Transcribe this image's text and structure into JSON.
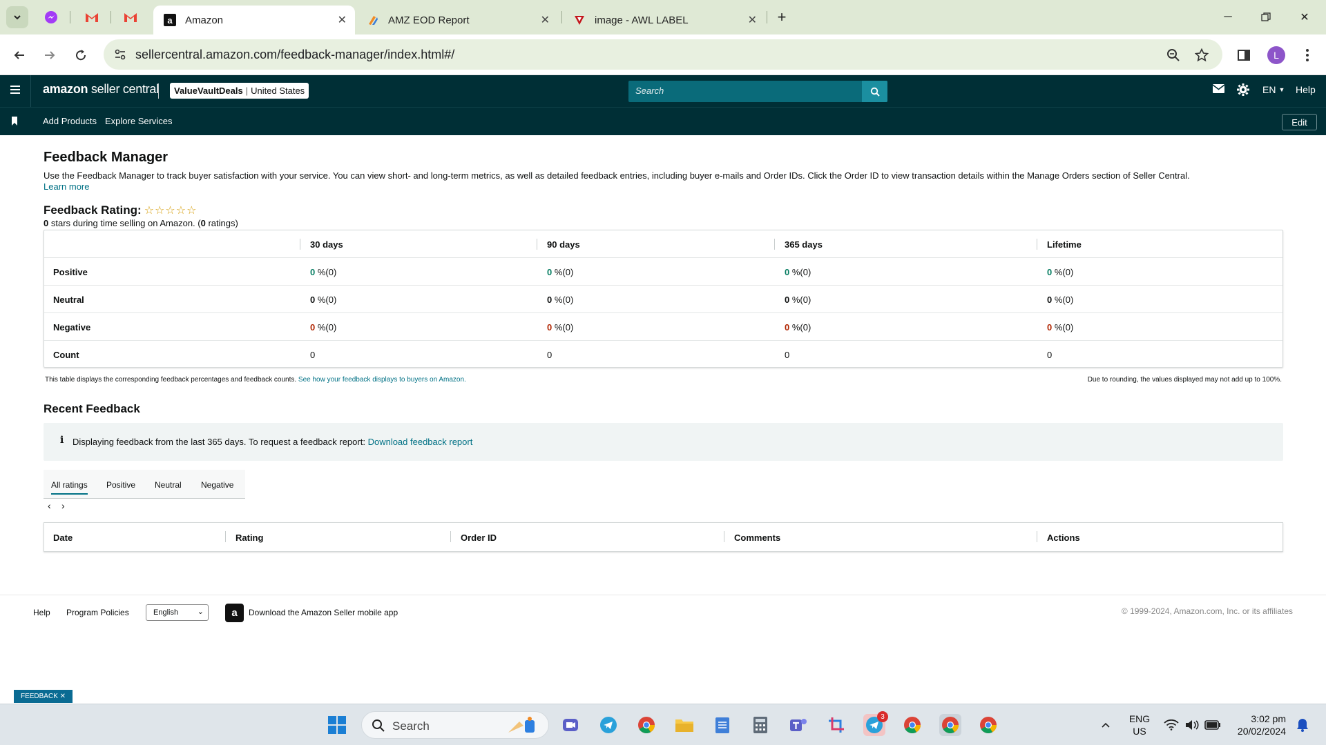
{
  "browser": {
    "tabs": [
      {
        "title": "Amazon",
        "active": true
      },
      {
        "title": "AMZ EOD Report",
        "active": false
      },
      {
        "title": "image - AWL LABEL",
        "active": false
      }
    ],
    "url": "sellercentral.amazon.com/feedback-manager/index.html#/",
    "profile_initial": "L"
  },
  "header": {
    "logo_main": "amazon",
    "logo_sub": "seller central",
    "store_name": "ValueVaultDeals",
    "marketplace": "United States",
    "search_placeholder": "Search",
    "language": "EN",
    "help": "Help"
  },
  "subnav": {
    "items": [
      "Add Products",
      "Explore Services"
    ],
    "edit": "Edit"
  },
  "page": {
    "title": "Feedback Manager",
    "intro": "Use the Feedback Manager to track buyer satisfaction with your service. You can view short- and long-term metrics, as well as detailed feedback entries, including buyer e-mails and Order IDs. Click the Order ID to view transaction details within the Manage Orders section of Seller Central.",
    "learn_more": "Learn more",
    "rating_label": "Feedback Rating:",
    "stars": "☆☆☆☆☆",
    "stars_count": "0",
    "rating_sub_1": " stars during time selling on Amazon. (",
    "ratings_count": "0",
    "rating_sub_2": " ratings)"
  },
  "feedback_table": {
    "columns": [
      "30 days",
      "90 days",
      "365 days",
      "Lifetime"
    ],
    "rows": [
      {
        "label": "Positive",
        "values": [
          "0",
          "0",
          "0",
          "0"
        ],
        "suffix": " %(0)"
      },
      {
        "label": "Neutral",
        "values": [
          "0",
          "0",
          "0",
          "0"
        ],
        "suffix": " %(0)"
      },
      {
        "label": "Negative",
        "values": [
          "0",
          "0",
          "0",
          "0"
        ],
        "suffix": " %(0)"
      },
      {
        "label": "Count",
        "values": [
          "0",
          "0",
          "0",
          "0"
        ]
      }
    ],
    "note_left": "This table displays the corresponding feedback percentages and feedback counts.",
    "note_link": "See how your feedback displays to buyers on Amazon.",
    "note_right": "Due to rounding, the values displayed may not add up to 100%."
  },
  "recent": {
    "title": "Recent Feedback",
    "info_icon": "i",
    "info_text": "Displaying feedback from the last 365 days. To request a feedback report:",
    "info_link": "Download feedback report",
    "tabs": [
      "All ratings",
      "Positive",
      "Neutral",
      "Negative"
    ],
    "selected_tab": "All ratings",
    "pager_prev": "‹",
    "pager_next": "›",
    "columns": [
      "Date",
      "Rating",
      "Order ID",
      "Comments",
      "Actions"
    ]
  },
  "footer": {
    "help": "Help",
    "policies": "Program Policies",
    "language": "English",
    "app_link": "Download the Amazon Seller mobile app",
    "copyright": "© 1999-2024, Amazon.com, Inc. or its affiliates"
  },
  "feedback_button": "FEEDBACK ✕",
  "taskbar": {
    "search": "Search",
    "telegram_badge": "3",
    "lang_line1": "ENG",
    "lang_line2": "US",
    "time": "3:02 pm",
    "date": "20/02/2024"
  },
  "colors": {
    "header_bg": "#002f36",
    "positive": "#067d62",
    "negative": "#b12704",
    "link": "#007185"
  }
}
